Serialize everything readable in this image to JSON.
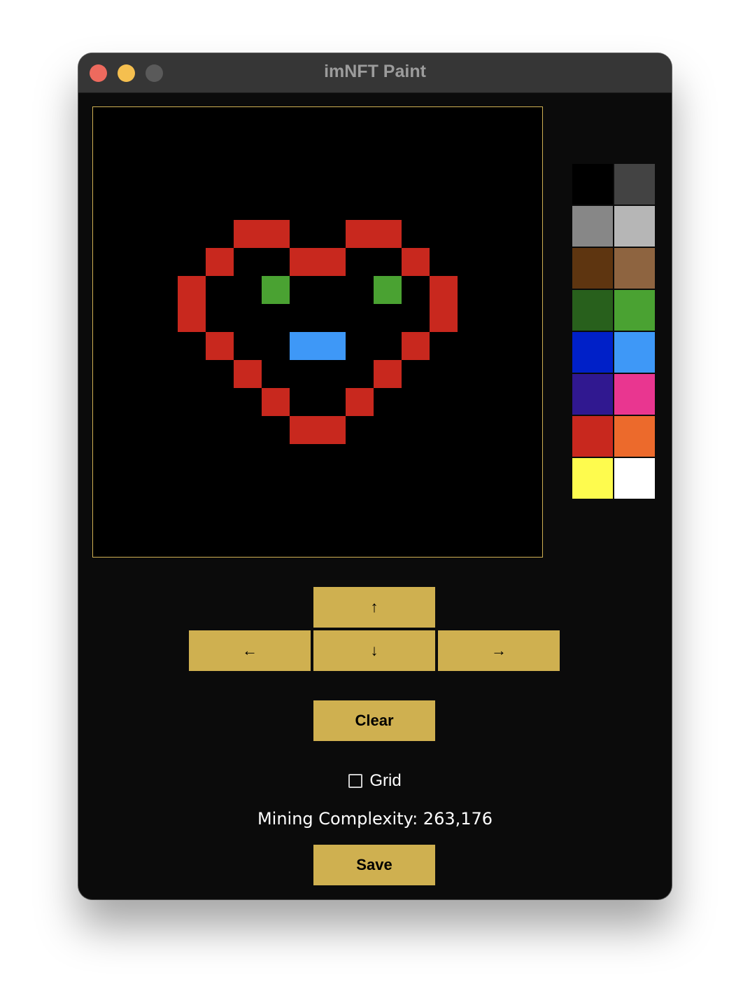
{
  "window": {
    "title": "imNFT Paint"
  },
  "canvas": {
    "background": "#000000",
    "border_color": "#d0b154",
    "grid_size": 16,
    "pixels": [
      {
        "col": 5,
        "row": 4,
        "color": "#c8281e"
      },
      {
        "col": 6,
        "row": 4,
        "color": "#c8281e"
      },
      {
        "col": 9,
        "row": 4,
        "color": "#c8281e"
      },
      {
        "col": 10,
        "row": 4,
        "color": "#c8281e"
      },
      {
        "col": 4,
        "row": 5,
        "color": "#c8281e"
      },
      {
        "col": 7,
        "row": 5,
        "color": "#c8281e"
      },
      {
        "col": 8,
        "row": 5,
        "color": "#c8281e"
      },
      {
        "col": 11,
        "row": 5,
        "color": "#c8281e"
      },
      {
        "col": 3,
        "row": 6,
        "color": "#c8281e"
      },
      {
        "col": 6,
        "row": 6,
        "color": "#4aa232"
      },
      {
        "col": 10,
        "row": 6,
        "color": "#4aa232"
      },
      {
        "col": 12,
        "row": 6,
        "color": "#c8281e"
      },
      {
        "col": 3,
        "row": 7,
        "color": "#c8281e"
      },
      {
        "col": 12,
        "row": 7,
        "color": "#c8281e"
      },
      {
        "col": 4,
        "row": 8,
        "color": "#c8281e"
      },
      {
        "col": 7,
        "row": 8,
        "color": "#3e98f7"
      },
      {
        "col": 8,
        "row": 8,
        "color": "#3e98f7"
      },
      {
        "col": 11,
        "row": 8,
        "color": "#c8281e"
      },
      {
        "col": 5,
        "row": 9,
        "color": "#c8281e"
      },
      {
        "col": 10,
        "row": 9,
        "color": "#c8281e"
      },
      {
        "col": 6,
        "row": 10,
        "color": "#c8281e"
      },
      {
        "col": 9,
        "row": 10,
        "color": "#c8281e"
      },
      {
        "col": 7,
        "row": 11,
        "color": "#c8281e"
      },
      {
        "col": 8,
        "row": 11,
        "color": "#c8281e"
      }
    ]
  },
  "palette": {
    "colors": [
      "#000000",
      "#434343",
      "#878787",
      "#b6b6b6",
      "#5e3510",
      "#8e6440",
      "#28601c",
      "#4aa232",
      "#0020c8",
      "#3e98f7",
      "#301890",
      "#e93690",
      "#c8281e",
      "#ec6a2c",
      "#fefb4e",
      "#ffffff"
    ]
  },
  "controls": {
    "up_label": "↑",
    "left_label": "←",
    "down_label": "↓",
    "right_label": "→",
    "clear_label": "Clear",
    "grid_label": "Grid",
    "grid_checked": false,
    "complexity_text": "Mining Complexity: 263,176",
    "save_label": "Save",
    "button_color": "#cfb050"
  }
}
